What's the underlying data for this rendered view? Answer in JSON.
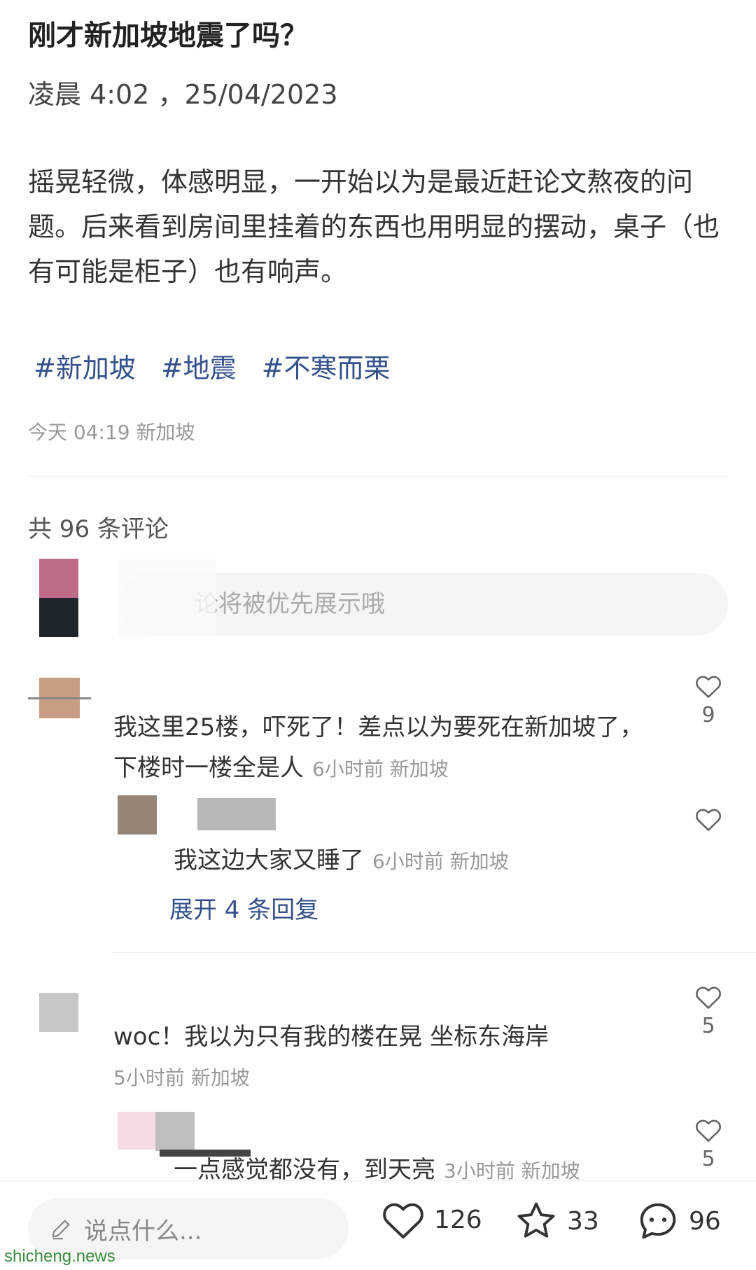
{
  "post": {
    "title": "刚才新加坡地震了吗？",
    "datetime": "凌晨 4:02 ，25/04/2023",
    "body": "摇晃轻微，体感明显，一开始以为是最近赶论文熬夜的问题。后来看到房间里挂着的东西也用明显的摆动，桌子（也有可能是柜子）也有响声。",
    "tags": [
      "#新加坡",
      "#地震",
      "#不寒而栗"
    ],
    "meta": "今天 04:19 新加坡"
  },
  "comments_header": {
    "count_label": "共 96 条评论"
  },
  "comment_input": {
    "placeholder": "论将被优先展示哦"
  },
  "comments": [
    {
      "text": "我这里25楼，吓死了！差点以为要死在新加坡了，下楼时一楼全是人",
      "meta": "6小时前 新加坡",
      "likes": "9"
    },
    {
      "text": "我这边大家又睡了",
      "meta": "6小时前 新加坡",
      "likes": ""
    },
    {
      "text": "woc！我以为只有我的楼在晃 坐标东海岸",
      "meta": "5小时前 新加坡",
      "likes": "5"
    },
    {
      "text": "一点感觉都没有，到天亮",
      "meta": "3小时前 新加坡",
      "likes": "5"
    }
  ],
  "expand_replies": "展开 4 条回复",
  "bottom_bar": {
    "placeholder": "说点什么...",
    "likes": "126",
    "stars": "33",
    "comments": "96"
  },
  "watermark": "shicheng.news",
  "colors": {
    "tag": "#34518c",
    "text": "#333333",
    "meta": "#999999"
  }
}
